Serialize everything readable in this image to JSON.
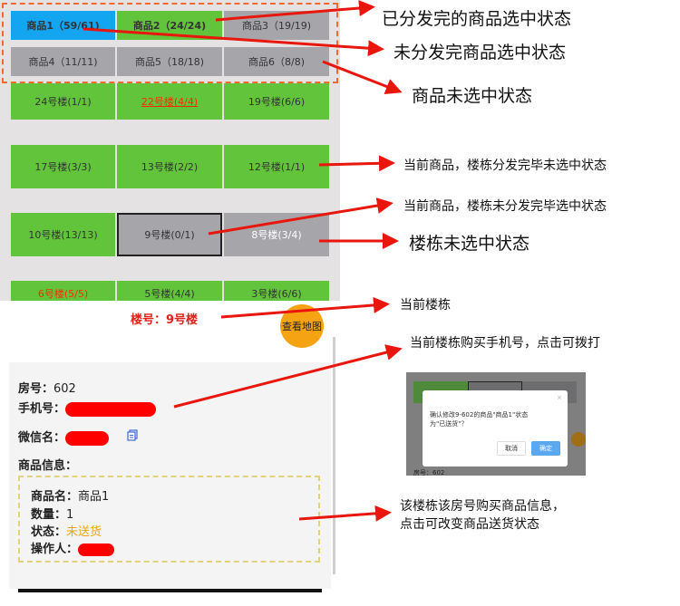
{
  "products": [
    {
      "label": "商品1（59/61)",
      "state": "done-selected"
    },
    {
      "label": "商品2（24/24)",
      "state": "done"
    },
    {
      "label": "商品3（19/19)",
      "state": "unselected"
    },
    {
      "label": "商品4（11/11)",
      "state": "unselected"
    },
    {
      "label": "商品5（18/18)",
      "state": "unselected"
    },
    {
      "label": "商品6（8/8)",
      "state": "unselected"
    }
  ],
  "buildings": [
    {
      "label": "24号楼(1/1)"
    },
    {
      "label": "22号楼(4/4)"
    },
    {
      "label": "19号楼(6/6)"
    },
    {
      "label": "17号楼(3/3)"
    },
    {
      "label": "13号楼(2/2)"
    },
    {
      "label": "12号楼(1/1)"
    },
    {
      "label": "10号楼(13/13)"
    },
    {
      "label": "9号楼(0/1)"
    },
    {
      "label": "8号楼(3/4)"
    },
    {
      "label": "6号楼(5/5)"
    },
    {
      "label": "5号楼(4/4)"
    },
    {
      "label": "3号楼(6/6)"
    }
  ],
  "current_building": "楼号：9号楼",
  "map_button": "查看地图",
  "info": {
    "room_label": "房号：",
    "room_value": "602",
    "phone_label": "手机号：",
    "wechat_label": "微信名：",
    "goods_label": "商品信息：",
    "goods_name_label": "商品名：",
    "goods_name_value": "商品1",
    "qty_label": "数量：",
    "qty_value": "1",
    "status_label": "状态：",
    "status_value": "未送货",
    "operator_label": "操作人："
  },
  "annotations": {
    "a1": "已分发完的商品选中状态",
    "a2": "未分发完商品选中状态",
    "a3": "商品未选中状态",
    "a4": "当前商品，楼栋分发完毕未选中状态",
    "a5": "当前商品，楼栋未分发完毕选中状态",
    "a6": "楼栋未选中状态",
    "a7": "当前楼栋",
    "a8": "当前楼栋购买手机号，点击可拨打",
    "a9_line1": "该楼栋该房号购买商品信息，",
    "a9_line2": "点击可改变商品送货状态"
  },
  "mini_dialog": {
    "text_line1": "确认修改9-602的商品\"商品1\"状态",
    "text_line2": "为\"已送货\"？",
    "cancel": "取消",
    "confirm": "确定",
    "room": "房号：602"
  },
  "colors": {
    "done_product": "#13a5f0",
    "green_cell": "#62c43b",
    "grey_cell": "#a6a5aa",
    "annotation_arrow": "#e8160c",
    "map_button": "#f6a313"
  }
}
